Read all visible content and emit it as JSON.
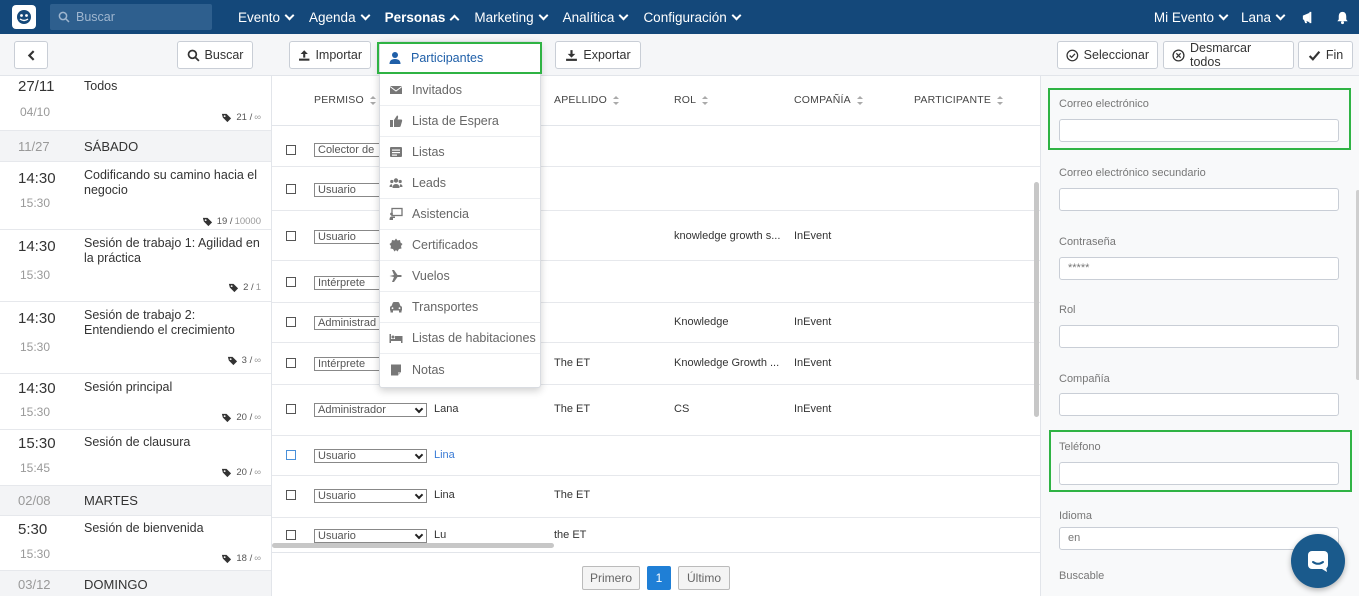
{
  "topnav": {
    "search_placeholder": "Buscar",
    "menu": [
      {
        "label": "Evento"
      },
      {
        "label": "Agenda"
      },
      {
        "label": "Personas"
      },
      {
        "label": "Marketing"
      },
      {
        "label": "Analítica"
      },
      {
        "label": "Configuración"
      }
    ],
    "right": {
      "event": "Mi Evento",
      "user": "Lana"
    }
  },
  "toolbar": {
    "search_label": "Buscar",
    "import_label": "Importar",
    "export_label": "Exportar",
    "select_label": "Seleccionar",
    "unselect_label": "Desmarcar todos",
    "done_label": "Fin"
  },
  "sidebar": {
    "items": [
      {
        "kind": "session",
        "time": "27/11",
        "end": "04/10",
        "title": "Todos",
        "count": "21",
        "max": "∞"
      },
      {
        "kind": "day",
        "date": "11/27",
        "weekday": "SÁBADO"
      },
      {
        "kind": "session",
        "time": "14:30",
        "end": "15:30",
        "title": "Codificando su camino hacia el negocio",
        "count": "19",
        "max": "10000"
      },
      {
        "kind": "session",
        "time": "14:30",
        "end": "15:30",
        "title": "Sesión de trabajo 1: Agilidad en la práctica",
        "count": "2",
        "max": "1"
      },
      {
        "kind": "session",
        "time": "14:30",
        "end": "15:30",
        "title": "Sesión de trabajo 2: Entendiendo el crecimiento",
        "count": "3",
        "max": "∞"
      },
      {
        "kind": "session",
        "time": "14:30",
        "end": "15:30",
        "title": "Sesión principal",
        "count": "20",
        "max": "∞"
      },
      {
        "kind": "session",
        "time": "15:30",
        "end": "15:45",
        "title": "Sesión de clausura",
        "count": "20",
        "max": "∞"
      },
      {
        "kind": "day",
        "date": "02/08",
        "weekday": "MARTES"
      },
      {
        "kind": "session",
        "time": "5:30",
        "end": "15:30",
        "title": "Sesión de bienvenida",
        "count": "18",
        "max": "∞"
      },
      {
        "kind": "day",
        "date": "03/12",
        "weekday": "DOMINGO"
      }
    ]
  },
  "table": {
    "headers": [
      "PERMISO",
      "APELLIDO",
      "ROL",
      "COMPAÑÍA",
      "PARTICIPANTE"
    ],
    "rows": [
      {
        "permission": "Colector de",
        "name": "",
        "last": "",
        "role": "",
        "company": ""
      },
      {
        "permission": "Usuario",
        "name": "",
        "last": "",
        "role": "",
        "company": ""
      },
      {
        "permission": "Usuario",
        "name": "",
        "last": "",
        "role": "knowledge growth s...",
        "company": "InEvent"
      },
      {
        "permission": "Intérprete",
        "name": "",
        "last": "",
        "role": "",
        "company": ""
      },
      {
        "permission": "Administrad",
        "name": "",
        "last": "",
        "role": "Knowledge",
        "company": "InEvent"
      },
      {
        "permission": "Intérprete",
        "name": "",
        "last": "The ET",
        "role": "Knowledge Growth ...",
        "company": "InEvent"
      },
      {
        "permission": "Administrador",
        "name": "Lana",
        "last": "The ET",
        "role": "CS",
        "company": "InEvent"
      },
      {
        "permission": "Usuario",
        "name": "Lina",
        "last": "",
        "role": "",
        "company": ""
      },
      {
        "permission": "Usuario",
        "name": "Lina",
        "last": "The ET",
        "role": "",
        "company": ""
      },
      {
        "permission": "Usuario",
        "name": "Lu",
        "last": "the ET",
        "role": "",
        "company": ""
      }
    ],
    "pager": {
      "first": "Primero",
      "page": "1",
      "last": "Último"
    }
  },
  "dropdown": {
    "items": [
      {
        "label": "Participantes",
        "icon": "user-icon"
      },
      {
        "label": "Invitados",
        "icon": "envelope-icon"
      },
      {
        "label": "Lista de Espera",
        "icon": "thumbs-up-icon"
      },
      {
        "label": "Listas",
        "icon": "list-icon"
      },
      {
        "label": "Leads",
        "icon": "users-icon"
      },
      {
        "label": "Asistencia",
        "icon": "presentation-icon"
      },
      {
        "label": "Certificados",
        "icon": "certificate-icon"
      },
      {
        "label": "Vuelos",
        "icon": "plane-icon"
      },
      {
        "label": "Transportes",
        "icon": "car-icon"
      },
      {
        "label": "Listas de habitaciones",
        "icon": "bed-icon"
      },
      {
        "label": "Notas",
        "icon": "note-icon"
      }
    ]
  },
  "form": {
    "email_label": "Correo electrónico",
    "email_value": "",
    "email2_label": "Correo electrónico secundario",
    "email2_value": "",
    "password_label": "Contraseña",
    "password_value": "*****",
    "role_label": "Rol",
    "role_value": "",
    "company_label": "Compañía",
    "company_value": "",
    "phone_label": "Teléfono",
    "phone_value": "",
    "language_label": "Idioma",
    "language_value": "en",
    "searchable_label": "Buscable"
  },
  "colors": {
    "nav": "#14487a",
    "highlight": "#2fb344",
    "accent": "#1f7fd6"
  }
}
